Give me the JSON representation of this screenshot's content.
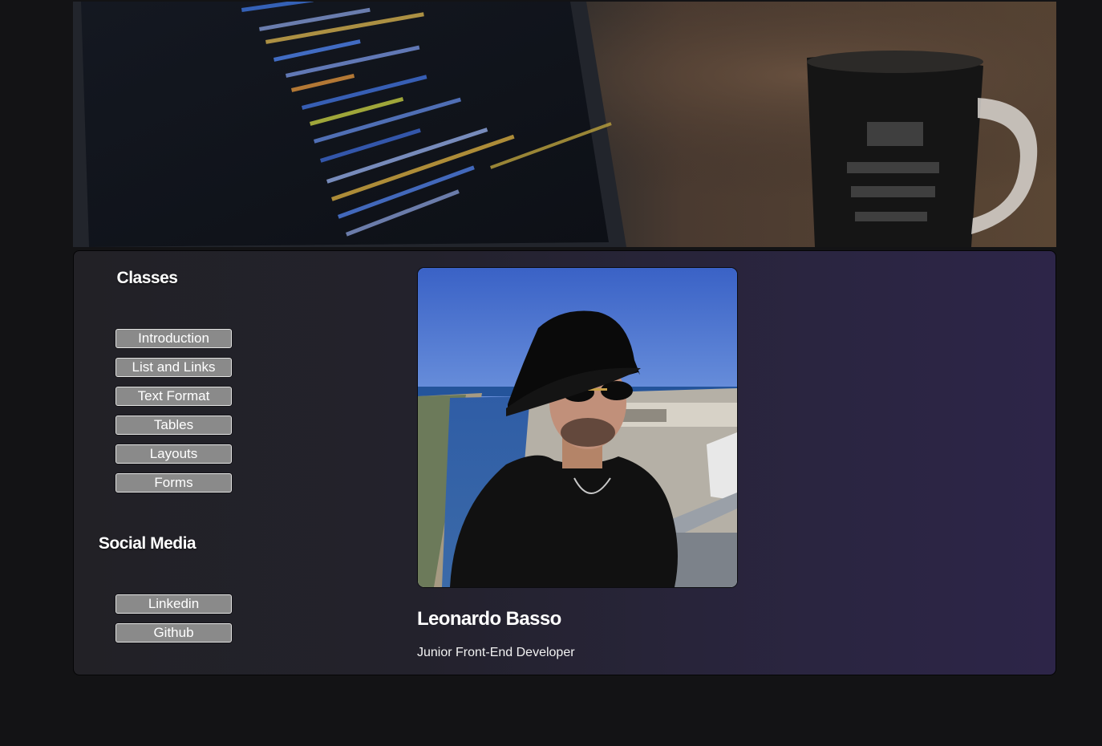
{
  "sidebar": {
    "classes_title": "Classes",
    "classes": [
      {
        "label": "Introduction"
      },
      {
        "label": "List and Links"
      },
      {
        "label": "Text Format"
      },
      {
        "label": "Tables"
      },
      {
        "label": "Layouts"
      },
      {
        "label": "Forms"
      }
    ],
    "social_title": "Social Media",
    "social": [
      {
        "label": "Linkedin"
      },
      {
        "label": "Github"
      }
    ]
  },
  "profile": {
    "name": "Leonardo Basso",
    "role": "Junior Front-End Developer"
  },
  "colors": {
    "page_background": "#131315",
    "card_gradient_start": "#222126",
    "card_gradient_end": "#2d2548",
    "button_background": "#8a8a8a",
    "button_border": "#e4e4e4"
  }
}
